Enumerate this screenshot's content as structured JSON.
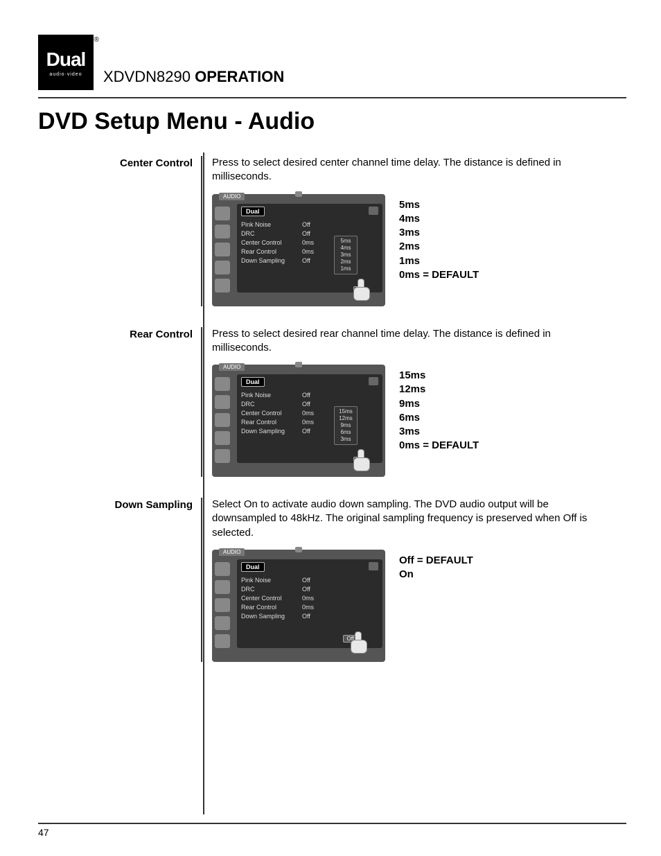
{
  "logo": {
    "main": "Dual",
    "sub": "audio·video",
    "reg": "®"
  },
  "header": {
    "model": "XDVDN8290",
    "operation": "OPERATION"
  },
  "page_title": "DVD Setup Menu - Audio",
  "page_number": "47",
  "menu_common": {
    "tab": "AUDIO",
    "panel_logo": "Dual",
    "rows": {
      "pink_noise": {
        "label": "Pink Noise",
        "value": "Off"
      },
      "drc": {
        "label": "DRC",
        "value": "Off"
      },
      "center": {
        "label": "Center Control",
        "value": "0ms"
      },
      "rear": {
        "label": "Rear Control",
        "value": "0ms"
      },
      "down": {
        "label": "Down Sampling",
        "value": "Off"
      }
    }
  },
  "sections": {
    "center": {
      "label": "Center Control",
      "desc": "Press to select desired center channel time delay. The distance is defined in milliseconds.",
      "popup": [
        "5ms",
        "4ms",
        "3ms",
        "2ms",
        "1ms"
      ],
      "popup_sel": "0",
      "values": [
        "5ms",
        "4ms",
        "3ms",
        "2ms",
        "1ms",
        "0ms = DEFAULT"
      ]
    },
    "rear": {
      "label": "Rear Control",
      "desc": "Press to select desired rear channel time delay. The distance is defined in milliseconds.",
      "popup": [
        "15ms",
        "12ms",
        "9ms",
        "6ms",
        "3ms"
      ],
      "popup_sel": "0",
      "values": [
        "15ms",
        "12ms",
        "9ms",
        "6ms",
        "3ms",
        "0ms = DEFAULT"
      ]
    },
    "down": {
      "label": "Down Sampling",
      "desc": "Select On to activate audio down sampling. The DVD audio output will be downsampled to 48kHz. The original sampling frequency is preserved when Off is selected.",
      "sel_label": "Off",
      "values": [
        "Off = DEFAULT",
        "On"
      ]
    }
  }
}
